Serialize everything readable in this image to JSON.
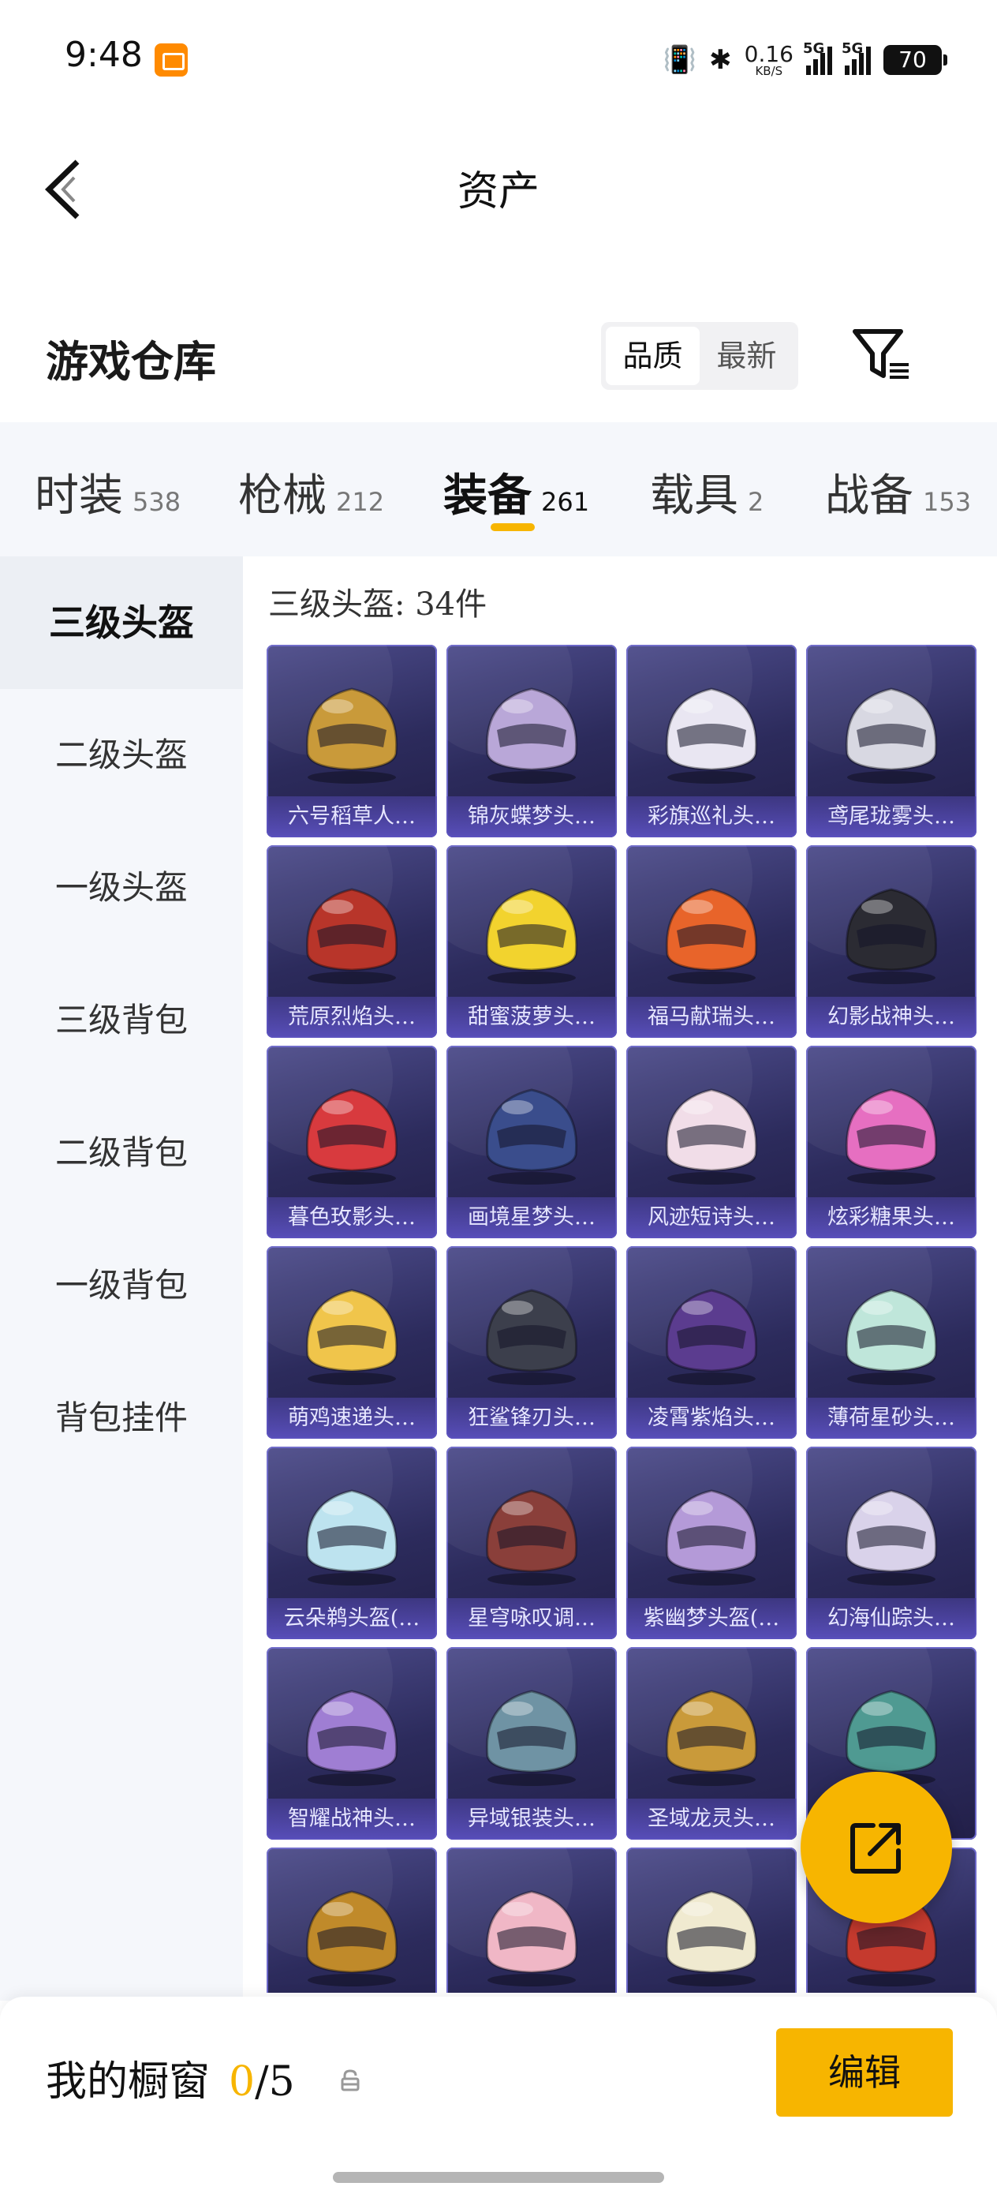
{
  "status_bar": {
    "time": "9:48",
    "net_speed_value": "0.16",
    "net_speed_unit": "KB/S",
    "signal1_label": "5G",
    "signal2_label": "5G",
    "battery": "70"
  },
  "header": {
    "title": "资产"
  },
  "warehouse": {
    "title": "游戏仓库",
    "sort_options": [
      "品质",
      "最新"
    ]
  },
  "tabs": [
    {
      "label": "时装",
      "count": "538"
    },
    {
      "label": "枪械",
      "count": "212"
    },
    {
      "label": "装备",
      "count": "261",
      "active": true
    },
    {
      "label": "载具",
      "count": "2"
    },
    {
      "label": "战备",
      "count": "153"
    }
  ],
  "sidebar": [
    {
      "label": "三级头盔",
      "active": true
    },
    {
      "label": "二级头盔"
    },
    {
      "label": "一级头盔"
    },
    {
      "label": "三级背包"
    },
    {
      "label": "二级背包"
    },
    {
      "label": "一级背包"
    },
    {
      "label": "背包挂件"
    }
  ],
  "content": {
    "count_label": "三级头盔: 34件",
    "items": [
      {
        "name": "六号稻草人…",
        "color": "#c99a3a"
      },
      {
        "name": "锦灰蝶梦头…",
        "color": "#b9a7d8"
      },
      {
        "name": "彩旗巡礼头…",
        "color": "#e9e6f2"
      },
      {
        "name": "鸢尾珑雾头…",
        "color": "#d8d8e2"
      },
      {
        "name": "荒原烈焰头…",
        "color": "#b8352a"
      },
      {
        "name": "甜蜜菠萝头…",
        "color": "#f2d32e"
      },
      {
        "name": "福马献瑞头…",
        "color": "#e8642a"
      },
      {
        "name": "幻影战神头…",
        "color": "#2b2b33"
      },
      {
        "name": "暮色玫影头…",
        "color": "#d83a3e"
      },
      {
        "name": "画境星梦头…",
        "color": "#3a4d8c"
      },
      {
        "name": "风迹短诗头…",
        "color": "#f1dde8"
      },
      {
        "name": "炫彩糖果头…",
        "color": "#e66fc1"
      },
      {
        "name": "萌鸡速递头…",
        "color": "#f0c54b"
      },
      {
        "name": "狂鲨锋刃头…",
        "color": "#3c3f4c"
      },
      {
        "name": "凌霄紫焰头…",
        "color": "#5b3c8f"
      },
      {
        "name": "薄荷星砂头…",
        "color": "#bfe6da"
      },
      {
        "name": "云朵鹈头盔(…",
        "color": "#bde3ef"
      },
      {
        "name": "星穹咏叹调…",
        "color": "#8a3f3a"
      },
      {
        "name": "紫幽梦头盔(…",
        "color": "#b49ad8"
      },
      {
        "name": "幻海仙踪头…",
        "color": "#d9d2ea"
      },
      {
        "name": "智耀战神头…",
        "color": "#9f7ed3"
      },
      {
        "name": "异域银装头…",
        "color": "#6f93a4"
      },
      {
        "name": "圣域龙灵头…",
        "color": "#c99a3a"
      },
      {
        "name": "",
        "color": "#4f9a92"
      },
      {
        "name": "",
        "color": "#c08a2a"
      },
      {
        "name": "",
        "color": "#f0b7c6"
      },
      {
        "name": "",
        "color": "#f0ead0"
      },
      {
        "name": "",
        "color": "#c53a2e"
      }
    ]
  },
  "bottom": {
    "my_window_label": "我的橱窗",
    "used": "0",
    "total": "/5",
    "edit_label": "编辑"
  },
  "colors": {
    "accent": "#f7b500",
    "card_bg": "#2c2b5c"
  }
}
